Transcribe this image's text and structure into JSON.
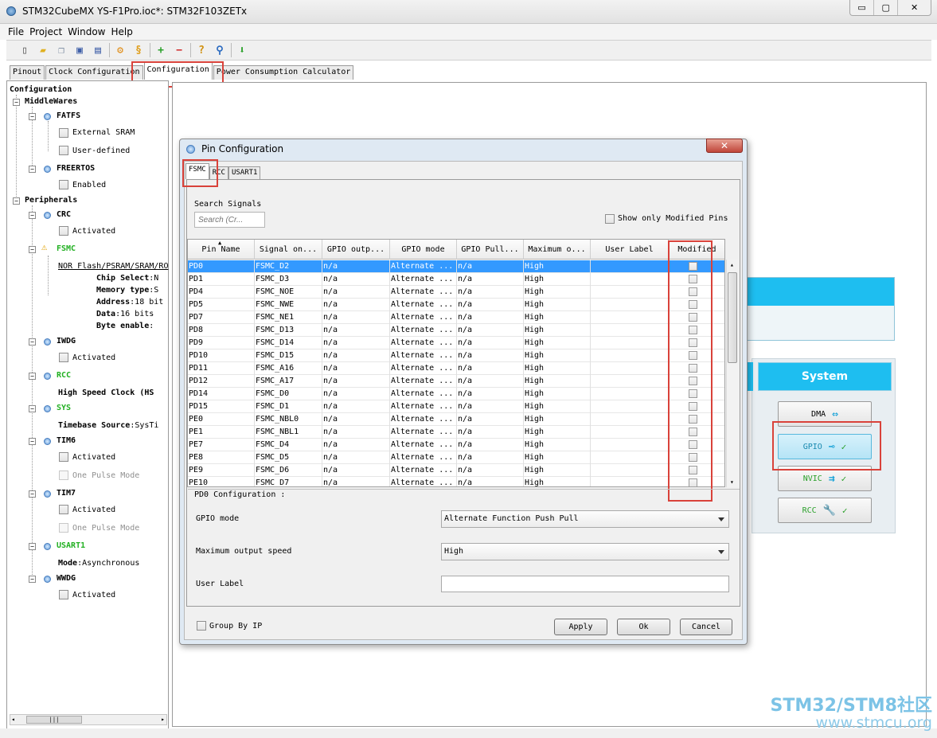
{
  "window": {
    "title": "STM32CubeMX YS-F1Pro.ioc*: STM32F103ZETx",
    "controls": [
      "▭",
      "▢",
      "✕"
    ]
  },
  "menu": [
    "File",
    "Project",
    "Window",
    "Help"
  ],
  "tabs": [
    "Pinout",
    "Clock Configuration",
    "Configuration",
    "Power Consumption Calculator"
  ],
  "tree": {
    "root": "Configuration",
    "middlewares": "MiddleWares",
    "fatfs": "FATFS",
    "fatfs_opts": [
      "External SRAM",
      "User-defined"
    ],
    "freertos": "FREERTOS",
    "freertos_opt": "Enabled",
    "peripherals": "Peripherals",
    "crc": "CRC",
    "activated": "Activated",
    "fsmc": "FSMC",
    "fsmc_sub": "NOR Flash/PSRAM/SRAM/RO",
    "fsmc_props": [
      {
        "k": "Chip Select",
        "v": ":N"
      },
      {
        "k": "Memory type",
        "v": ":S"
      },
      {
        "k": "Address",
        "v": ":18 bit"
      },
      {
        "k": "Data",
        "v": ":16 bits"
      },
      {
        "k": "Byte enable",
        "v": ":"
      }
    ],
    "iwdg": "IWDG",
    "rcc": "RCC",
    "rcc_prop": "High Speed Clock (HS",
    "sys": "SYS",
    "sys_prop_k": "Timebase Source",
    "sys_prop_v": ":SysTi",
    "tim6": "TIM6",
    "one_pulse": "One Pulse Mode",
    "tim7": "TIM7",
    "usart1": "USART1",
    "usart1_prop_k": "Mode",
    "usart1_prop_v": ":Asynchronous",
    "wwdg": "WWDG"
  },
  "system_panel": {
    "title": "System",
    "buttons": [
      "DMA",
      "GPIO",
      "NVIC",
      "RCC"
    ],
    "colors": {
      "accent": "#1ebef0",
      "highlight": "#d9423a"
    }
  },
  "dialog": {
    "title": "Pin Configuration",
    "close": "✕",
    "tabs": [
      "FSMC",
      "RCC",
      "USART1"
    ],
    "search_label": "Search Signals",
    "search_placeholder": "Search (Cr...",
    "show_modified_label": "Show only Modified Pins",
    "columns": [
      "Pin Name",
      "Signal on...",
      "GPIO outp...",
      "GPIO mode",
      "GPIO Pull...",
      "Maximum o...",
      "User Label",
      "Modified"
    ],
    "rows": [
      [
        "PD0",
        "FSMC_D2",
        "n/a",
        "Alternate ...",
        "n/a",
        "High",
        ""
      ],
      [
        "PD1",
        "FSMC_D3",
        "n/a",
        "Alternate ...",
        "n/a",
        "High",
        ""
      ],
      [
        "PD4",
        "FSMC_NOE",
        "n/a",
        "Alternate ...",
        "n/a",
        "High",
        ""
      ],
      [
        "PD5",
        "FSMC_NWE",
        "n/a",
        "Alternate ...",
        "n/a",
        "High",
        ""
      ],
      [
        "PD7",
        "FSMC_NE1",
        "n/a",
        "Alternate ...",
        "n/a",
        "High",
        ""
      ],
      [
        "PD8",
        "FSMC_D13",
        "n/a",
        "Alternate ...",
        "n/a",
        "High",
        ""
      ],
      [
        "PD9",
        "FSMC_D14",
        "n/a",
        "Alternate ...",
        "n/a",
        "High",
        ""
      ],
      [
        "PD10",
        "FSMC_D15",
        "n/a",
        "Alternate ...",
        "n/a",
        "High",
        ""
      ],
      [
        "PD11",
        "FSMC_A16",
        "n/a",
        "Alternate ...",
        "n/a",
        "High",
        ""
      ],
      [
        "PD12",
        "FSMC_A17",
        "n/a",
        "Alternate ...",
        "n/a",
        "High",
        ""
      ],
      [
        "PD14",
        "FSMC_D0",
        "n/a",
        "Alternate ...",
        "n/a",
        "High",
        ""
      ],
      [
        "PD15",
        "FSMC_D1",
        "n/a",
        "Alternate ...",
        "n/a",
        "High",
        ""
      ],
      [
        "PE0",
        "FSMC_NBL0",
        "n/a",
        "Alternate ...",
        "n/a",
        "High",
        ""
      ],
      [
        "PE1",
        "FSMC_NBL1",
        "n/a",
        "Alternate ...",
        "n/a",
        "High",
        ""
      ],
      [
        "PE7",
        "FSMC_D4",
        "n/a",
        "Alternate ...",
        "n/a",
        "High",
        ""
      ],
      [
        "PE8",
        "FSMC_D5",
        "n/a",
        "Alternate ...",
        "n/a",
        "High",
        ""
      ],
      [
        "PE9",
        "FSMC_D6",
        "n/a",
        "Alternate ...",
        "n/a",
        "High",
        ""
      ],
      [
        "PE10",
        "FSMC_D7",
        "n/a",
        "Alternate ...",
        "n/a",
        "High",
        ""
      ]
    ],
    "selected_row": 0,
    "config_title": "PD0 Configuration :",
    "gpio_mode_label": "GPIO mode",
    "gpio_mode_value": "Alternate Function Push Pull",
    "max_speed_label": "Maximum output speed",
    "max_speed_value": "High",
    "user_label_label": "User Label",
    "user_label_value": "",
    "group_by_label": "Group By IP",
    "buttons": {
      "apply": "Apply",
      "ok": "Ok",
      "cancel": "Cancel"
    }
  },
  "watermark": {
    "line1": "STM32/STM8社区",
    "line2": "www.stmcu.org"
  }
}
